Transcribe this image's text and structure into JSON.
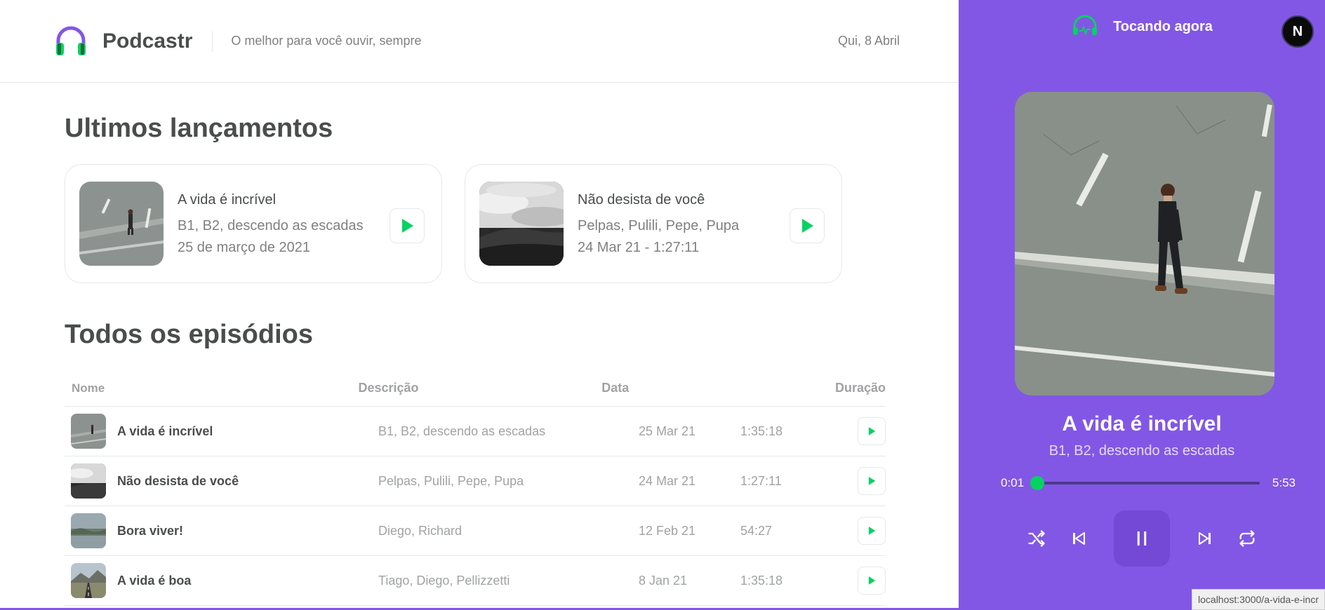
{
  "header": {
    "logo_text": "Podcastr",
    "tagline": "O melhor para você ouvir, sempre",
    "date": "Qui, 8 Abril"
  },
  "latest": {
    "title": "Ultimos lançamentos",
    "episodes": [
      {
        "title": "A vida é incrível",
        "members": "B1, B2, descendo as escadas",
        "date": "25 de março de 2021"
      },
      {
        "title": "Não desista de você",
        "members": "Pelpas, Pulili, Pepe, Pupa",
        "date": "24 Mar 21 - 1:27:11"
      }
    ]
  },
  "all": {
    "title": "Todos os episódios",
    "columns": {
      "name": "Nome",
      "description": "Descrição",
      "date": "Data",
      "duration": "Duração"
    },
    "rows": [
      {
        "title": "A vida é incrível",
        "members": "B1, B2, descendo as escadas",
        "date": "25 Mar 21",
        "duration": "1:35:18"
      },
      {
        "title": "Não desista de você",
        "members": "Pelpas, Pulili, Pepe, Pupa",
        "date": "24 Mar 21",
        "duration": "1:27:11"
      },
      {
        "title": "Bora viver!",
        "members": "Diego, Richard",
        "date": "12 Feb 21",
        "duration": "54:27"
      },
      {
        "title": "A vida é boa",
        "members": "Tiago, Diego, Pellizzetti",
        "date": "8 Jan 21",
        "duration": "1:35:18"
      }
    ]
  },
  "player": {
    "header_title": "Tocando agora",
    "avatar_letter": "N",
    "episode_title": "A vida é incrível",
    "episode_members": "B1, B2, descendo as escadas",
    "current_time": "0:01",
    "total_time": "5:53",
    "progress": 0.003
  },
  "status_url": "localhost:3000/a-vida-e-incr",
  "colors": {
    "accent": "#8257e5",
    "green": "#04d361",
    "text": "#494d4b",
    "muted": "#808080"
  },
  "icons": [
    "headphones-icon",
    "play-icon",
    "shuffle-icon",
    "previous-icon",
    "pause-icon",
    "next-icon",
    "repeat-icon"
  ]
}
